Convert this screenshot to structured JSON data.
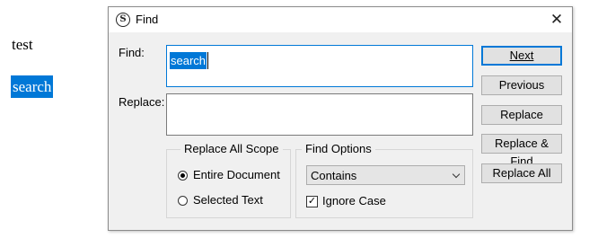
{
  "document": {
    "line1": "test",
    "selected_word": "search"
  },
  "dialog": {
    "title": "Find",
    "find_label": "Find:",
    "find_value": "search",
    "replace_label": "Replace:",
    "replace_value": "",
    "buttons": {
      "next": "Next",
      "previous": "Previous",
      "replace": "Replace",
      "replace_and_find": "Replace & Find",
      "replace_all": "Replace All"
    },
    "scope_group": {
      "title": "Replace All Scope",
      "entire_document": "Entire Document",
      "selected_text": "Selected Text",
      "selected": "Entire Document"
    },
    "options_group": {
      "title": "Find Options",
      "match_mode": "Contains",
      "ignore_case_label": "Ignore Case",
      "ignore_case_checked": true
    },
    "close_icon": "close-icon",
    "app_icon": "app-logo-icon"
  },
  "colors": {
    "selection": "#0078d7",
    "dialog_bg": "#f0f0f0",
    "button_bg": "#e1e1e1"
  }
}
